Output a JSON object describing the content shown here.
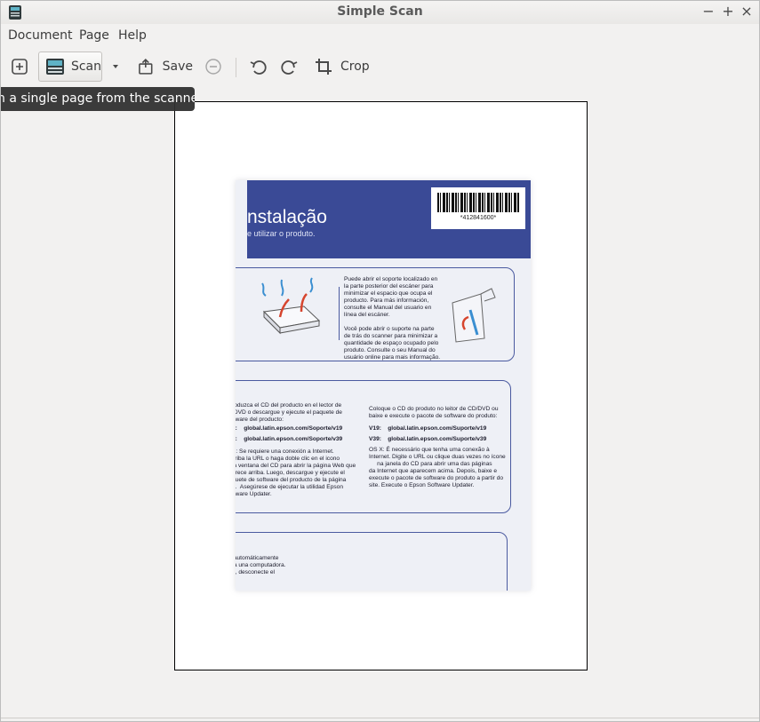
{
  "window": {
    "title": "Simple Scan",
    "controls": {
      "minimize": "−",
      "maximize": "+",
      "close": "×"
    }
  },
  "menubar": {
    "items": [
      {
        "label": "Document"
      },
      {
        "label": "Page"
      },
      {
        "label": "Help"
      }
    ]
  },
  "toolbar": {
    "scan_label": "Scan",
    "save_label": "Save",
    "crop_label": "Crop",
    "icons": [
      "new-document-icon",
      "scanner-icon",
      "dropdown-arrow-icon",
      "save-icon",
      "zoom-out-icon",
      "rotate-left-icon",
      "rotate-right-icon",
      "crop-icon"
    ]
  },
  "tooltip": {
    "text": "n a single page from the scanner"
  },
  "scan": {
    "banner_title": "nstalação",
    "banner_subtitle": "e utilizar o produto.",
    "barcode_text": "*412841600*",
    "box1_right": "Puede abrir el soporte localizado en\nla parte posterior del escáner para\nminimizar el espacio que ocupa el\nproducto. Para más información,\nconsulte el Manual del usuario en\nlínea del escáner.\n\nVocê pode abrir o suporte na parte\nde trás do scanner para minimizar a\nquantidade de espaço ocupado pelo\nproduto. Consulte o seu Manual do\nusuário online para mais informação.",
    "box2_left_top": "roduzca el CD del producto en el lector de\n/DVD o descargue y ejecute el paquete de\nftware del producto:",
    "box2_left_v19": "9:    global.latin.epson.com/Soporte/v19",
    "box2_left_v39": "8:    global.latin.epson.com/Soporte/v39",
    "box2_left_osx": "X: Se requiere una conexión a Internet.\ncriba la URL o haga doble clic en el icono\nla ventana del CD para abrir la página Web que\narece arriba. Luego, descargue y ejecute el\nquete de software del producto de la página\nb.  Asegúrese de ejecutar la utilidad Epson\nftware Updater.",
    "box2_right_top": "Coloque o CD do produto no leitor de CD/DVD ou\nbaixe e execute o pacote de software do produto:",
    "box2_right_v19": "V19:    global.latin.epson.com/Suporte/v19",
    "box2_right_v39": "V39:    global.latin.epson.com/Suporte/v39",
    "box2_right_osx": "OS X: É necessário que tenha uma conexão à\nInternet. Digite o URL ou clique duas vezes no ícone\n     na janela do CD para abrir uma das páginas\nda Internet que aparecem acima. Depois, baixe e\nexecute o pacote de software do produto a partir do\nsite. Execute o Epson Software Updater.",
    "box3_left": " automáticamente\n a una computadora.\nb, desconecte el"
  },
  "colors": {
    "banner": "#3a4a96",
    "tooltip_bg": "#303030",
    "window_bg": "#f2f1f0"
  }
}
